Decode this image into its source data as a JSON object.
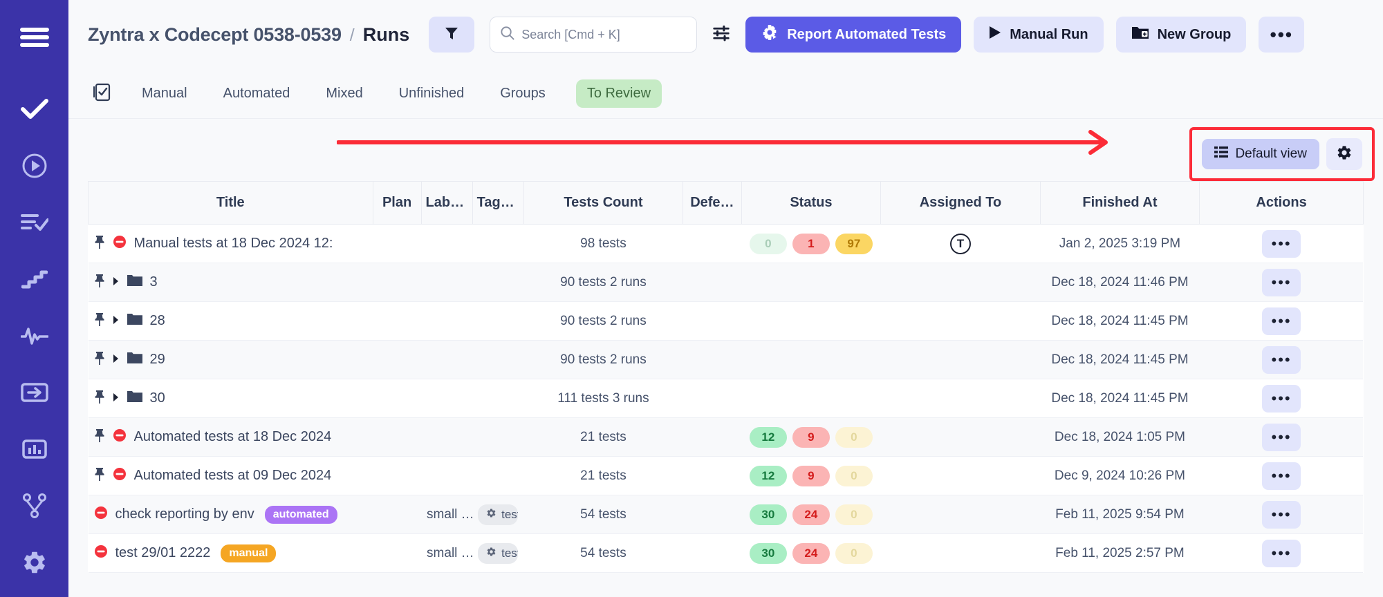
{
  "sidebar": {
    "items": [
      {
        "icon": "hamburger-menu-icon",
        "name": "menu-toggle"
      },
      {
        "icon": "check-icon",
        "name": "sidebar-item-tests"
      },
      {
        "icon": "play-circle-icon",
        "name": "sidebar-item-runs"
      },
      {
        "icon": "list-check-icon",
        "name": "sidebar-item-plans"
      },
      {
        "icon": "steps-icon",
        "name": "sidebar-item-steps"
      },
      {
        "icon": "activity-pulse-icon",
        "name": "sidebar-item-activity"
      },
      {
        "icon": "login-box-arrow-icon",
        "name": "sidebar-item-import"
      },
      {
        "icon": "bar-chart-icon",
        "name": "sidebar-item-analytics"
      },
      {
        "icon": "git-branch-icon",
        "name": "sidebar-item-integrations"
      },
      {
        "icon": "gear-icon",
        "name": "sidebar-item-settings"
      }
    ],
    "bg_color": "#3b33a8"
  },
  "header": {
    "project": "Zyntra x Codecept 0538-0539",
    "separator": "/",
    "page": "Runs",
    "filter_icon": "funnel-filter-icon",
    "search": {
      "placeholder": "Search [Cmd + K]",
      "value": "",
      "icon": "search-icon"
    },
    "sliders_icon": "sliders-settings-icon",
    "buttons": {
      "report_automated": "Report Automated Tests",
      "report_automated_icon": "robot-gear-icon",
      "manual_run": "Manual Run",
      "manual_run_icon": "play-triangle-icon",
      "new_group": "New Group",
      "new_group_icon": "folder-plus-icon",
      "more": "•••"
    },
    "accent_color": "#5b5be6"
  },
  "tabs": [
    {
      "label": "",
      "icon": "clipboard-check-icon",
      "active": false,
      "pill": false
    },
    {
      "label": "Manual",
      "active": false,
      "pill": false
    },
    {
      "label": "Automated",
      "active": false,
      "pill": false
    },
    {
      "label": "Mixed",
      "active": false,
      "pill": false
    },
    {
      "label": "Unfinished",
      "active": false,
      "pill": false
    },
    {
      "label": "Groups",
      "active": false,
      "pill": false
    },
    {
      "label": "To Review",
      "active": true,
      "pill": true,
      "pill_bg": "#c6ebc5",
      "pill_fg": "#3f6b40"
    }
  ],
  "view_toolbar": {
    "view_label": "Default view",
    "view_icon": "list-view-icon",
    "gear_icon": "gear-icon",
    "highlight_color": "#fc2b38",
    "annotation": "red-arrow-pointing-right"
  },
  "table": {
    "columns": [
      "Title",
      "Plan",
      "Labels",
      "Tags…",
      "Tests Count",
      "Defe…",
      "Status",
      "Assigned To",
      "Finished At",
      "Actions"
    ],
    "rows": [
      {
        "pinned": true,
        "expandable": false,
        "folder": false,
        "status_icon": "blocked-circle-icon",
        "title": "Manual tests at 18 Dec 2024 12:",
        "badge": null,
        "plan": "",
        "labels": "",
        "tags": null,
        "tests_count": "98 tests",
        "defects": "",
        "status": {
          "passed": "0",
          "failed": "1",
          "skipped": "97",
          "passed_dim": true,
          "failed_dim": false,
          "skipped_dim": false
        },
        "assigned_to": "T",
        "finished_at": "Jan 2, 2025 3:19 PM",
        "actions": "•••"
      },
      {
        "pinned": true,
        "expandable": true,
        "folder": true,
        "status_icon": null,
        "title": "3",
        "badge": null,
        "plan": "",
        "labels": "",
        "tags": null,
        "tests_count": "90 tests 2 runs",
        "defects": "",
        "status": null,
        "assigned_to": "",
        "finished_at": "Dec 18, 2024 11:46 PM",
        "actions": "•••"
      },
      {
        "pinned": true,
        "expandable": true,
        "folder": true,
        "status_icon": null,
        "title": "28",
        "badge": null,
        "plan": "",
        "labels": "",
        "tags": null,
        "tests_count": "90 tests 2 runs",
        "defects": "",
        "status": null,
        "assigned_to": "",
        "finished_at": "Dec 18, 2024 11:45 PM",
        "actions": "•••"
      },
      {
        "pinned": true,
        "expandable": true,
        "folder": true,
        "status_icon": null,
        "title": "29",
        "badge": null,
        "plan": "",
        "labels": "",
        "tags": null,
        "tests_count": "90 tests 2 runs",
        "defects": "",
        "status": null,
        "assigned_to": "",
        "finished_at": "Dec 18, 2024 11:45 PM",
        "actions": "•••"
      },
      {
        "pinned": true,
        "expandable": true,
        "folder": true,
        "status_icon": null,
        "title": "30",
        "badge": null,
        "plan": "",
        "labels": "",
        "tags": null,
        "tests_count": "111 tests 3 runs",
        "defects": "",
        "status": null,
        "assigned_to": "",
        "finished_at": "Dec 18, 2024 11:45 PM",
        "actions": "•••"
      },
      {
        "pinned": true,
        "expandable": false,
        "folder": false,
        "status_icon": "blocked-circle-icon",
        "title": "Automated tests at 18 Dec 2024",
        "badge": null,
        "plan": "",
        "labels": "",
        "tags": null,
        "tests_count": "21 tests",
        "defects": "",
        "status": {
          "passed": "12",
          "failed": "9",
          "skipped": "0",
          "passed_dim": false,
          "failed_dim": false,
          "skipped_dim": true
        },
        "assigned_to": "",
        "finished_at": "Dec 18, 2024 1:05 PM",
        "actions": "•••"
      },
      {
        "pinned": true,
        "expandable": false,
        "folder": false,
        "status_icon": "blocked-circle-icon",
        "title": "Automated tests at 09 Dec 2024",
        "badge": null,
        "plan": "",
        "labels": "",
        "tags": null,
        "tests_count": "21 tests",
        "defects": "",
        "status": {
          "passed": "12",
          "failed": "9",
          "skipped": "0",
          "passed_dim": false,
          "failed_dim": false,
          "skipped_dim": true
        },
        "assigned_to": "",
        "finished_at": "Dec 9, 2024 10:26 PM",
        "actions": "•••"
      },
      {
        "pinned": false,
        "expandable": false,
        "folder": false,
        "status_icon": "blocked-circle-icon",
        "title": "check reporting by env",
        "badge": {
          "text": "automated",
          "type": "automated"
        },
        "plan": "",
        "labels": "small …",
        "tags": {
          "text": "test",
          "icon": "gear-icon"
        },
        "tests_count": "54 tests",
        "defects": "",
        "status": {
          "passed": "30",
          "failed": "24",
          "skipped": "0",
          "passed_dim": false,
          "failed_dim": false,
          "skipped_dim": true
        },
        "assigned_to": "",
        "finished_at": "Feb 11, 2025 9:54 PM",
        "actions": "•••"
      },
      {
        "pinned": false,
        "expandable": false,
        "folder": false,
        "status_icon": "blocked-circle-icon",
        "title": "test 29/01 2222",
        "badge": {
          "text": "manual",
          "type": "manual"
        },
        "plan": "",
        "labels": "small …",
        "tags": {
          "text": "test",
          "icon": "gear-icon"
        },
        "tests_count": "54 tests",
        "defects": "",
        "status": {
          "passed": "30",
          "failed": "24",
          "skipped": "0",
          "passed_dim": false,
          "failed_dim": false,
          "skipped_dim": true
        },
        "assigned_to": "",
        "finished_at": "Feb 11, 2025 2:57 PM",
        "actions": "•••"
      }
    ]
  }
}
